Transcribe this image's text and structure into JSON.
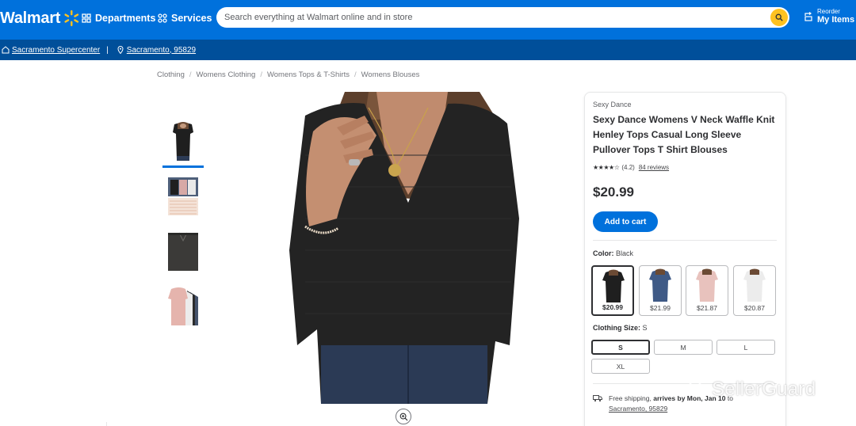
{
  "header": {
    "logo_text": "Walmart",
    "departments_label": "Departments",
    "services_label": "Services",
    "search_placeholder": "Search everything at Walmart online and in store",
    "reorder_label": "Reorder",
    "my_items_label": "My Items",
    "brand_color": "#0071dc",
    "spark_color": "#ffc220"
  },
  "store_bar": {
    "store_name": "Sacramento Supercenter",
    "separator": "|",
    "location": "Sacramento, 95829"
  },
  "breadcrumb": [
    "Clothing",
    "Womens Clothing",
    "Womens Tops & T-Shirts",
    "Womens Blouses"
  ],
  "breadcrumb_separator": "/",
  "product": {
    "brand": "Sexy Dance",
    "title": "Sexy Dance Womens V Neck Waffle Knit Henley Tops Casual Long Sleeve Pullover Tops T Shirt Blouses",
    "rating_stars": "★★★★☆",
    "rating_value": "(4.2)",
    "reviews_link": "84 reviews",
    "price": "$20.99",
    "add_to_cart_label": "Add to cart",
    "color_label": "Color:",
    "color_value": "Black",
    "colors": [
      {
        "name": "Black",
        "price": "$20.99",
        "selected": true
      },
      {
        "name": "Blue",
        "price": "$21.99",
        "selected": false
      },
      {
        "name": "Pink",
        "price": "$21.87",
        "selected": false
      },
      {
        "name": "White",
        "price": "$20.87",
        "selected": false
      }
    ],
    "size_label": "Clothing Size:",
    "size_value": "S",
    "sizes": [
      "S",
      "M",
      "L",
      "XL"
    ],
    "shipping_text": "Free shipping,",
    "arrives_label": "arrives by",
    "arrives_date": "Mon, Jan 10",
    "to_label": "to",
    "shipping_location": "Sacramento, 95829",
    "gallery_thumbnails": [
      "black-top-front",
      "size-chart",
      "black-top-flat",
      "pink-top-variants"
    ]
  },
  "watermark": {
    "text": "SellerGuard"
  }
}
